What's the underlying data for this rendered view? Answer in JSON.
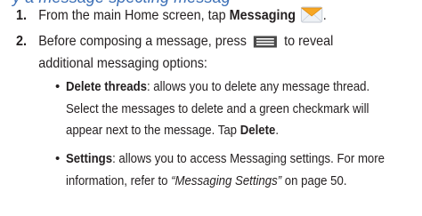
{
  "heading_fragment": "y a message specting messag",
  "steps": [
    {
      "number": "1.",
      "text_before": "From the main Home screen, tap ",
      "bold": "Messaging",
      "icon": "envelope-icon"
    },
    {
      "number": "2.",
      "line1_before": "Before composing a message, press ",
      "icon": "menu-key-icon",
      "line1_after": " to reveal",
      "line2": "additional messaging options:"
    }
  ],
  "bullets": [
    {
      "term": "Delete threads",
      "line1_rest": ": allows you to delete any message thread.",
      "line2": "Select the messages to delete and a green checkmark will",
      "line3_before": "appear next to the message. Tap ",
      "line3_bold": "Delete",
      "line3_after": "."
    },
    {
      "term": "Settings",
      "line1_rest": ": allows you to access Messaging settings. For more",
      "line2_before": "information, refer to ",
      "line2_ref": "“Messaging Settings”",
      "line2_after": " on page 50."
    }
  ],
  "bullet_glyph": "•",
  "colors": {
    "text": "#231f20",
    "heading": "#3b6fb6",
    "envelope_top": "#f6a623",
    "envelope_body": "#f0f2f6",
    "menu_key": "#4a4a4a"
  }
}
